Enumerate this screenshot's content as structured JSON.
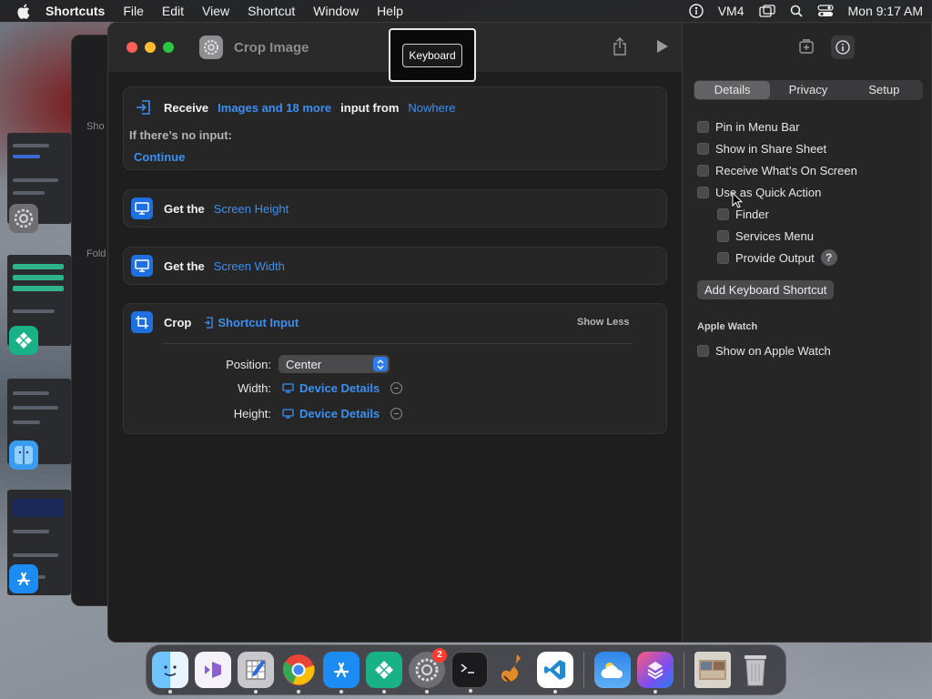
{
  "menubar": {
    "app_name": "Shortcuts",
    "items": [
      "File",
      "Edit",
      "View",
      "Shortcut",
      "Window",
      "Help"
    ],
    "status_text": "VM4",
    "clock": "Mon 9:17 AM"
  },
  "background_window": {
    "label1": "Sho",
    "label2": "Fold"
  },
  "window": {
    "title": "Crop Image",
    "tooltip": "Keyboard"
  },
  "actions": {
    "receive": {
      "verb": "Receive",
      "types": "Images and 18 more",
      "mid": "input from",
      "source": "Nowhere",
      "no_input_label": "If there’s no input:",
      "no_input_action": "Continue"
    },
    "height": {
      "verb": "Get the",
      "param": "Screen Height"
    },
    "width": {
      "verb": "Get the",
      "param": "Screen Width"
    },
    "crop": {
      "verb": "Crop",
      "input": "Shortcut Input",
      "toggle": "Show Less",
      "position_label": "Position:",
      "position_value": "Center",
      "width_label": "Width:",
      "width_value": "Device Details",
      "height_label": "Height:",
      "height_value": "Device Details"
    }
  },
  "inspector": {
    "tabs": [
      "Details",
      "Privacy",
      "Setup"
    ],
    "active_tab": "Details",
    "options": {
      "pin_menu_bar": "Pin in Menu Bar",
      "share_sheet": "Show in Share Sheet",
      "on_screen": "Receive What’s On Screen",
      "quick_action": "Use as Quick Action",
      "finder": "Finder",
      "services_menu": "Services Menu",
      "provide_output": "Provide Output"
    },
    "help_glyph": "?",
    "add_shortcut_button": "Add Keyboard Shortcut",
    "apple_watch_header": "Apple Watch",
    "apple_watch_option": "Show on Apple Watch"
  },
  "dock": {
    "settings_badge": "2"
  },
  "colors": {
    "accent_blue": "#3d8fef",
    "action_icon_blue": "#1e6fe0",
    "window_bg": "#1e1e1f"
  }
}
